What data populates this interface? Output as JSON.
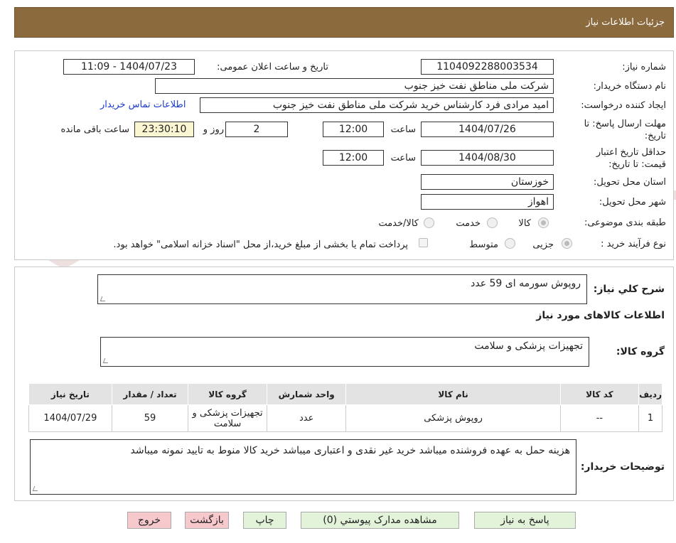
{
  "header": {
    "title": "جزئیات اطلاعات نیاز"
  },
  "form": {
    "need_number_label": "شماره نیاز:",
    "need_number": "1104092288003534",
    "announce_label": "تاریخ و ساعت اعلان عمومی:",
    "announce_value": "1404/07/23 - 11:09",
    "buyer_label": "نام دستگاه خریدار:",
    "buyer_value": "شرکت ملی مناطق نفت خیز جنوب",
    "creator_label": "ایجاد کننده درخواست:",
    "creator_value": "امید مرادی فرد کارشناس خرید شرکت ملی مناطق نفت خیز جنوب",
    "contact_link": "اطلاعات تماس خریدار",
    "deadline_label_1": "مهلت ارسال پاسخ: تا",
    "deadline_label_2": "تاریخ:",
    "deadline_date": "1404/07/26",
    "time_label": "ساعت",
    "deadline_time": "12:00",
    "days_value": "2",
    "days_label": "روز و",
    "remaining_time": "23:30:10",
    "remaining_label": "ساعت باقی مانده",
    "validity_label_1": "حداقل تاریخ اعتبار",
    "validity_label_2": "قیمت: تا تاریخ:",
    "validity_date": "1404/08/30",
    "validity_time": "12:00",
    "province_label": "استان محل تحویل:",
    "province_value": "خوزستان",
    "city_label": "شهر محل تحویل:",
    "city_value": "اهواز",
    "category_label": "طبقه بندی موضوعی:",
    "category_options": [
      "کالا",
      "خدمت",
      "کالا/خدمت"
    ],
    "process_label": "نوع فرآیند خرید :",
    "process_options": [
      "جزیی",
      "متوسط"
    ],
    "payment_note": "پرداخت تمام یا بخشی از مبلغ خرید،از محل \"اسناد خزانه اسلامی\" خواهد بود."
  },
  "summary": {
    "desc_label": "شرح کلي نياز:",
    "desc_value": "روپوش سورمه ای 59 عدد",
    "goods_info_title": "اطلاعات کالاهای مورد نیاز",
    "group_label": "گروه کالا:",
    "group_value": "تجهیزات پزشکی و سلامت"
  },
  "table": {
    "headers": [
      "ردیف",
      "کد کالا",
      "نام کالا",
      "واحد شمارش",
      "گروه کالا",
      "تعداد / مقدار",
      "تاریخ نیاز"
    ],
    "rows": [
      [
        "1",
        "--",
        "روپوش پزشکی",
        "عدد",
        "تجهیزات پزشکی و سلامت",
        "59",
        "1404/07/29"
      ]
    ]
  },
  "notes": {
    "label": "توضیحات خریدار:",
    "value": "هزینه حمل به عهده فروشنده میباشد خرید غیر نقدی و اعتباری میباشد خرید کالا منوط به تایید نمونه میباشد"
  },
  "buttons": {
    "reply": "پاسخ به نیاز",
    "attachments": "مشاهده مدارک پیوستي (0)",
    "print": "چاپ",
    "back": "بازگشت",
    "exit": "خروج"
  },
  "watermark": {
    "text": "AriaTender.neT"
  },
  "colors": {
    "header_bg": "#8b6a3e",
    "button_green": "#e2f3d9",
    "button_pink": "#f7c9cd",
    "highlight": "#fbf6d2",
    "link": "#1a3ccf"
  }
}
